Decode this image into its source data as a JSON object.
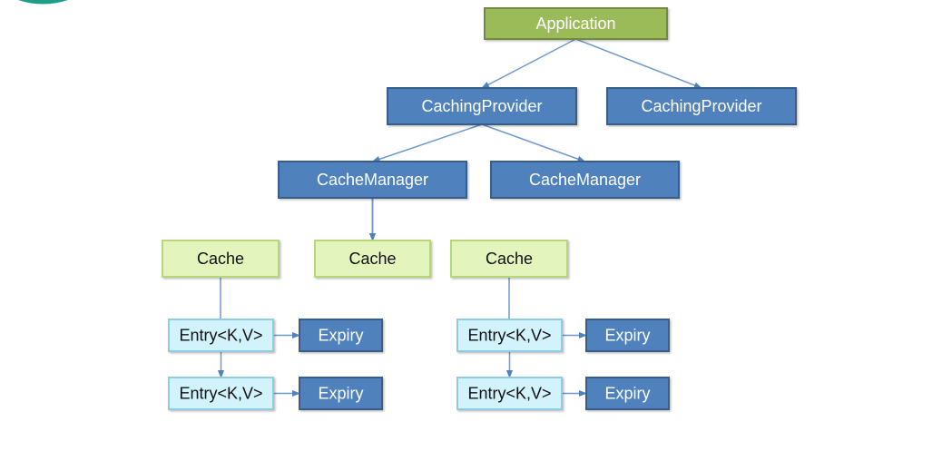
{
  "diagram": {
    "colors": {
      "application_fill": "#9bbb59",
      "application_stroke": "#71893f",
      "blue_fill": "#4f81bd",
      "blue_stroke": "#385d8a",
      "cache_fill": "#e3f5bd",
      "cache_stroke": "#b5d77a",
      "entry_fill": "#d2f2fc",
      "entry_stroke": "#8fcbe3",
      "connector": "#6f97cc"
    },
    "nodes": {
      "application": "Application",
      "caching_provider_1": "CachingProvider",
      "caching_provider_2": "CachingProvider",
      "cache_manager_1": "CacheManager",
      "cache_manager_2": "CacheManager",
      "cache_1": "Cache",
      "cache_2": "Cache",
      "cache_3": "Cache",
      "entry_1": "Entry<K,V>",
      "entry_2": "Entry<K,V>",
      "entry_3": "Entry<K,V>",
      "entry_4": "Entry<K,V>",
      "expiry_1": "Expiry",
      "expiry_2": "Expiry",
      "expiry_3": "Expiry",
      "expiry_4": "Expiry"
    },
    "edges": [
      [
        "application",
        "caching_provider_1"
      ],
      [
        "application",
        "caching_provider_2"
      ],
      [
        "caching_provider_1",
        "cache_manager_1"
      ],
      [
        "caching_provider_1",
        "cache_manager_2"
      ],
      [
        "cache_manager_1",
        "cache_1"
      ],
      [
        "cache_manager_1",
        "cache_2"
      ],
      [
        "cache_manager_1",
        "cache_3"
      ],
      [
        "cache_1",
        "entry_1"
      ],
      [
        "entry_1",
        "entry_2"
      ],
      [
        "cache_3",
        "entry_3"
      ],
      [
        "entry_3",
        "entry_4"
      ],
      [
        "entry_1",
        "expiry_1"
      ],
      [
        "entry_2",
        "expiry_2"
      ],
      [
        "entry_3",
        "expiry_3"
      ],
      [
        "entry_4",
        "expiry_4"
      ]
    ]
  }
}
